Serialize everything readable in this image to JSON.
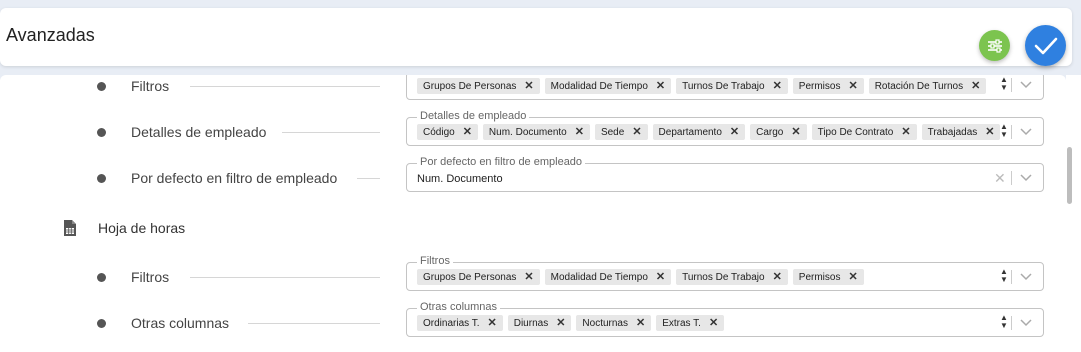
{
  "header": {
    "title": "Avanzadas"
  },
  "rows": {
    "filtros1": {
      "label": "Filtros",
      "chips": [
        "Grupos De Personas",
        "Modalidad De Tiempo",
        "Turnos De Trabajo",
        "Permisos",
        "Rotación De Turnos"
      ]
    },
    "detalles": {
      "label": "Detalles de empleado",
      "legend": "Detalles de empleado",
      "chips": [
        "Código",
        "Num. Documento",
        "Sede",
        "Departamento",
        "Cargo",
        "Tipo De Contrato",
        "Trabajadas"
      ]
    },
    "defecto": {
      "label": "Por defecto en filtro de empleado",
      "legend": "Por defecto en filtro de empleado",
      "value": "Num. Documento"
    }
  },
  "section": {
    "title": "Hoja de horas",
    "icon": "spreadsheet-icon"
  },
  "rows2": {
    "filtros2": {
      "label": "Filtros",
      "legend": "Filtros",
      "chips": [
        "Grupos De Personas",
        "Modalidad De Tiempo",
        "Turnos De Trabajo",
        "Permisos"
      ]
    },
    "otras": {
      "label": "Otras columnas",
      "legend": "Otras columnas",
      "chips": [
        "Ordinarias T.",
        "Diurnas",
        "Nocturnas",
        "Extras T."
      ]
    }
  },
  "colors": {
    "confirm": "#2f80e0",
    "filter": "#7cc44f"
  }
}
